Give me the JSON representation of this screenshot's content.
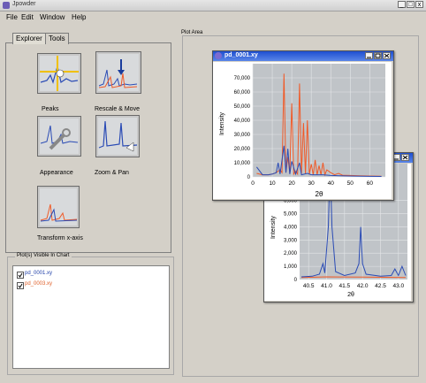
{
  "app": {
    "title": "Jpowder"
  },
  "window_controls": {
    "minimize": "_",
    "maximize": "□",
    "close": "x"
  },
  "menu": [
    "File",
    "Edit",
    "Window",
    "Help"
  ],
  "tabs": [
    {
      "label": "Explorer"
    },
    {
      "label": "Tools"
    }
  ],
  "tools": [
    {
      "label": "Peaks",
      "icon": "peaks-icon"
    },
    {
      "label": "Rescale & Move",
      "icon": "rescale-move-icon"
    },
    {
      "label": "Appearance",
      "icon": "appearance-icon"
    },
    {
      "label": "Zoom & Pan",
      "icon": "zoom-pan-icon"
    },
    {
      "label": "Transform x-axis",
      "icon": "transform-x-axis-icon"
    }
  ],
  "plots_visible": {
    "title": "Plot(s) Visible In Chart",
    "items": [
      {
        "label": "pd_0001.xy",
        "checked": true,
        "color": "#1f3fa8"
      },
      {
        "label": "pd_0003.xy",
        "checked": true,
        "color": "#e0602a"
      }
    ]
  },
  "plot_area": {
    "label": "Plot Area"
  },
  "colors": {
    "series1": "#2a4bb5",
    "series2": "#f05a28",
    "titlebar": "#1e4ed0"
  },
  "frames": [
    {
      "title": "pd_0001.xy"
    },
    {
      "title": ""
    }
  ],
  "chart_data": [
    {
      "type": "line",
      "title": "pd_0001.xy",
      "xlabel": "2θ",
      "ylabel": "Intensity",
      "xlim": [
        0,
        68
      ],
      "ylim": [
        0,
        80000
      ],
      "x_ticks": [
        "0",
        "10",
        "20",
        "30",
        "40",
        "50",
        "60"
      ],
      "y_ticks": [
        "0",
        "10,000",
        "20,000",
        "30,000",
        "40,000",
        "50,000",
        "60,000",
        "70,000"
      ],
      "grid": true,
      "series": [
        {
          "values": [
            [
              2,
              7000
            ],
            [
              5,
              1500
            ],
            [
              8,
              1500
            ],
            [
              10,
              2000
            ],
            [
              12,
              3000
            ],
            [
              13,
              10000
            ],
            [
              14,
              2000
            ],
            [
              16,
              22000
            ],
            [
              17,
              3000
            ],
            [
              18,
              20000
            ],
            [
              19,
              2000
            ],
            [
              20,
              11000
            ],
            [
              22,
              2000
            ],
            [
              24,
              10000
            ],
            [
              25,
              1500
            ],
            [
              28,
              2500
            ],
            [
              30,
              1500
            ],
            [
              33,
              1500
            ],
            [
              36,
              1500
            ],
            [
              40,
              1000
            ],
            [
              45,
              800
            ],
            [
              50,
              600
            ],
            [
              60,
              400
            ],
            [
              66,
              300
            ]
          ]
        },
        {
          "values": [
            [
              2,
              2500
            ],
            [
              5,
              1500
            ],
            [
              8,
              1500
            ],
            [
              10,
              2000
            ],
            [
              12,
              3000
            ],
            [
              14,
              5000
            ],
            [
              15,
              3000
            ],
            [
              16,
              73000
            ],
            [
              17,
              3000
            ],
            [
              18,
              14000
            ],
            [
              19,
              2500
            ],
            [
              20,
              52000
            ],
            [
              21,
              2000
            ],
            [
              22,
              4000
            ],
            [
              23,
              2000
            ],
            [
              24,
              66000
            ],
            [
              25,
              2000
            ],
            [
              26,
              38000
            ],
            [
              27,
              2000
            ],
            [
              28,
              40000
            ],
            [
              29,
              1800
            ],
            [
              30,
              9000
            ],
            [
              31,
              1500
            ],
            [
              32,
              12000
            ],
            [
              33,
              1500
            ],
            [
              34,
              8000
            ],
            [
              35,
              1500
            ],
            [
              36,
              10000
            ],
            [
              37,
              1500
            ],
            [
              38,
              5000
            ],
            [
              40,
              3000
            ],
            [
              42,
              1500
            ],
            [
              44,
              2500
            ],
            [
              46,
              1200
            ],
            [
              50,
              1000
            ],
            [
              55,
              800
            ],
            [
              60,
              600
            ],
            [
              66,
              500
            ]
          ]
        }
      ]
    },
    {
      "type": "line",
      "xlabel": "2θ",
      "ylabel": "Intensity",
      "xlim": [
        40.25,
        43.25
      ],
      "ylim": [
        0,
        8800
      ],
      "x_ticks": [
        "40.5",
        "41.0",
        "41.5",
        "42.0",
        "42.5",
        "43.0"
      ],
      "y_ticks": [
        "0",
        "1,000",
        "2,000",
        "3,000",
        "4,000",
        "5,000",
        "6,000"
      ],
      "grid": true,
      "series": [
        {
          "values": [
            [
              40.3,
              200
            ],
            [
              40.6,
              250
            ],
            [
              40.8,
              400
            ],
            [
              40.9,
              1200
            ],
            [
              40.95,
              500
            ],
            [
              41.05,
              4000
            ],
            [
              41.1,
              8800
            ],
            [
              41.15,
              4000
            ],
            [
              41.25,
              600
            ],
            [
              41.5,
              300
            ],
            [
              41.8,
              500
            ],
            [
              41.9,
              1200
            ],
            [
              41.95,
              4000
            ],
            [
              42.0,
              1200
            ],
            [
              42.1,
              400
            ],
            [
              42.5,
              250
            ],
            [
              42.8,
              300
            ],
            [
              42.9,
              800
            ],
            [
              43.0,
              300
            ],
            [
              43.1,
              1000
            ],
            [
              43.2,
              300
            ]
          ]
        },
        {
          "values": [
            [
              40.3,
              150
            ],
            [
              41.0,
              200
            ],
            [
              42.0,
              180
            ],
            [
              43.2,
              150
            ]
          ]
        }
      ]
    }
  ]
}
